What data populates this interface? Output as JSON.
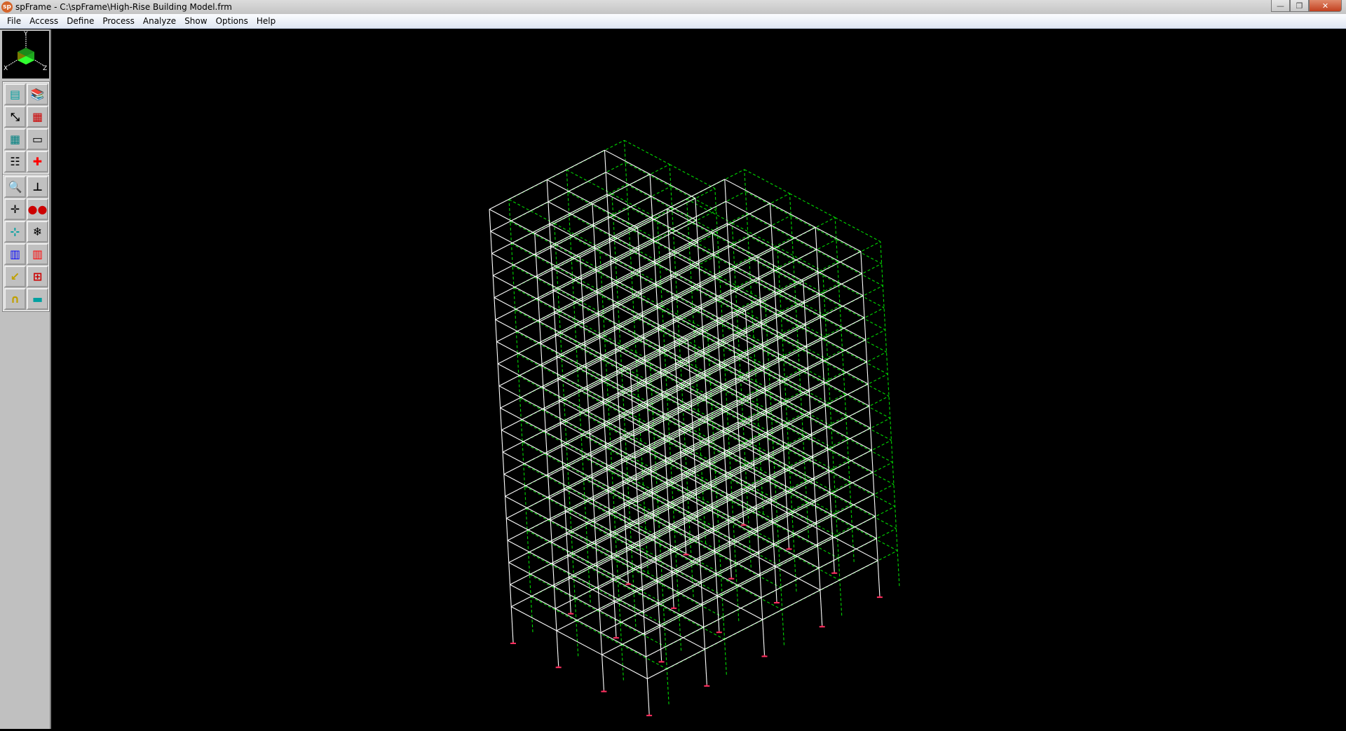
{
  "window": {
    "app_icon": "sp",
    "title": "spFrame - C:\\spFrame\\High-Rise Building Model.frm",
    "minimize": "—",
    "restore": "❐",
    "close": "✕"
  },
  "menu": [
    "File",
    "Access",
    "Define",
    "Process",
    "Analyze",
    "Show",
    "Options",
    "Help"
  ],
  "triad": {
    "x": "X",
    "y": "Y",
    "z": "Z"
  },
  "toolbar_group1": [
    "file-cabinet-icon",
    "books-icon",
    "fit-page-icon",
    "frame-section-icon",
    "spreadsheet-icon",
    "monitor-icon",
    "list-icon",
    "red-cross-icon"
  ],
  "toolbar_group2": [
    "zoom-icon",
    "axes-icon",
    "pan-icon",
    "glasses-view-icon",
    "shrink-icon",
    "explode-icon",
    "frame-blue-icon",
    "frame-red-icon",
    "select-arrow-icon",
    "loads-icon",
    "curve-load-icon",
    "member-shrink-icon"
  ],
  "colors": {
    "frame": "#ffffff",
    "analytical": "#00d800",
    "support": "#ff3060"
  }
}
